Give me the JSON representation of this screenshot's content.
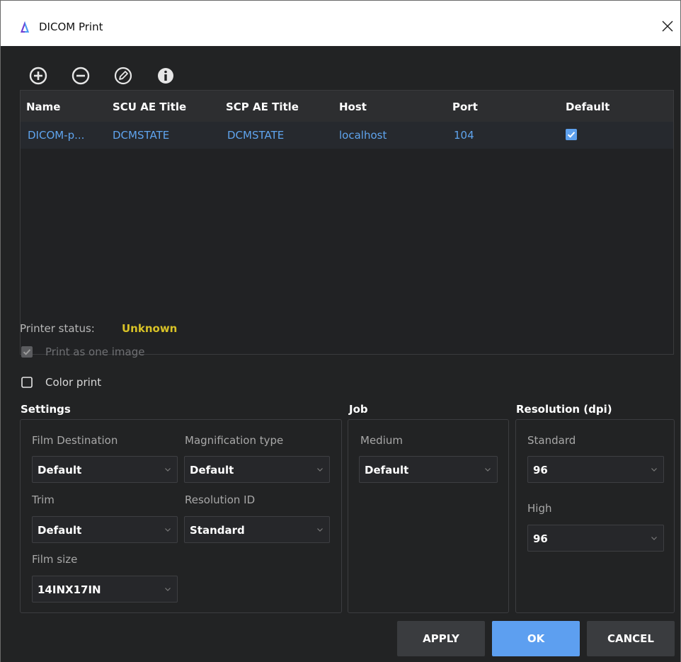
{
  "window": {
    "title": "DICOM Print",
    "colors": {
      "logo_purple": "#6f3ed2",
      "logo_blue": "#4a9ef4"
    }
  },
  "toolbar": {
    "icons": [
      "add-icon",
      "remove-icon",
      "edit-icon",
      "info-icon"
    ]
  },
  "table": {
    "columns": [
      "Name",
      "SCU AE Title",
      "SCP AE Title",
      "Host",
      "Port",
      "Default"
    ],
    "rows": [
      {
        "name": "DICOM-p...",
        "scu": "DCMSTATE",
        "scp": "DCMSTATE",
        "host": "localhost",
        "port": "104",
        "default": true
      }
    ]
  },
  "status": {
    "label": "Printer status:",
    "value": "Unknown",
    "value_color": "#d8c227"
  },
  "options": {
    "print_one": {
      "label": "Print as one image",
      "checked": true,
      "disabled": true
    },
    "color_print": {
      "label": "Color print",
      "checked": false
    }
  },
  "settings": {
    "title": "Settings",
    "film_destination": {
      "label": "Film Destination",
      "value": "Default"
    },
    "magnification_type": {
      "label": "Magnification type",
      "value": "Default"
    },
    "trim": {
      "label": "Trim",
      "value": "Default"
    },
    "resolution_id": {
      "label": "Resolution ID",
      "value": "Standard"
    },
    "film_size": {
      "label": "Film size",
      "value": "14INX17IN"
    }
  },
  "job": {
    "title": "Job",
    "medium": {
      "label": "Medium",
      "value": "Default"
    }
  },
  "resolution": {
    "title": "Resolution (dpi)",
    "standard": {
      "label": "Standard",
      "value": "96"
    },
    "high": {
      "label": "High",
      "value": "96"
    }
  },
  "buttons": {
    "apply": "APPLY",
    "ok": "OK",
    "cancel": "CANCEL",
    "colors": {
      "primary": "#5d9ff0",
      "secondary": "#3a3c3f"
    }
  }
}
